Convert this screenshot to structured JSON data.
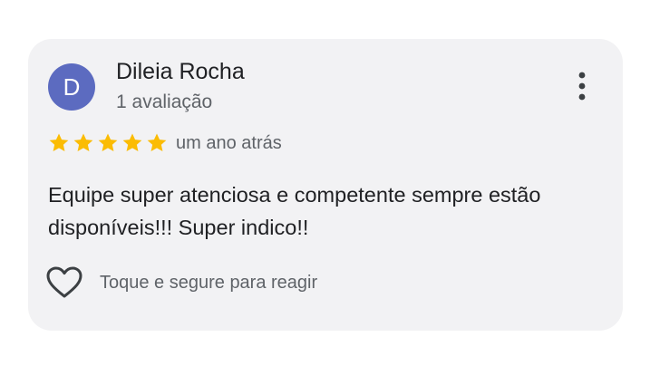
{
  "review": {
    "author": {
      "initial": "D",
      "name": "Dileia Rocha",
      "review_count": "1 avaliação",
      "avatar_color": "#5c6bc0"
    },
    "rating": {
      "stars": 5,
      "max": 5,
      "star_color": "#fbbc04"
    },
    "time_ago": "um ano atrás",
    "text": "Equipe super atenciosa e competente sempre estão disponíveis!!! Super indico!!",
    "more_icon": "more-vert-icon",
    "reaction": {
      "icon": "heart-outline-icon",
      "label": "Toque e segure para reagir"
    }
  }
}
